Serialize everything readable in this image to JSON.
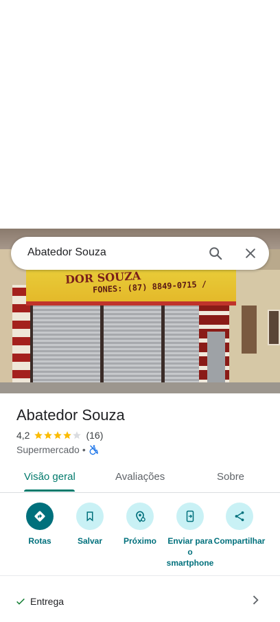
{
  "search": {
    "value": "Abatedor Souza"
  },
  "photo": {
    "sign_line1": "DOR SOUZA",
    "sign_line2": "FONES: (87) 8849-0715 /"
  },
  "place": {
    "name": "Abatedor Souza",
    "rating": "4,2",
    "rating_value": 4.2,
    "stars_filled": 4,
    "review_count": "(16)",
    "category": "Supermercado",
    "separator": "•"
  },
  "tabs": [
    {
      "label": "Visão geral",
      "selected": true
    },
    {
      "label": "Avaliações",
      "selected": false
    },
    {
      "label": "Sobre",
      "selected": false
    }
  ],
  "actions": [
    {
      "label": "Rotas",
      "icon": "directions-icon"
    },
    {
      "label": "Salvar",
      "icon": "bookmark-icon"
    },
    {
      "label": "Próximo",
      "icon": "nearby-icon"
    },
    {
      "label": "Enviar para o smartphone",
      "icon": "send-to-phone-icon"
    },
    {
      "label": "Compartilhar",
      "icon": "share-icon"
    }
  ],
  "attributes": [
    {
      "label": "Entrega",
      "available": true
    }
  ],
  "colors": {
    "accent": "#00707c",
    "star": "#fbbc04",
    "check": "#188038",
    "tab_selected": "#00796b"
  }
}
